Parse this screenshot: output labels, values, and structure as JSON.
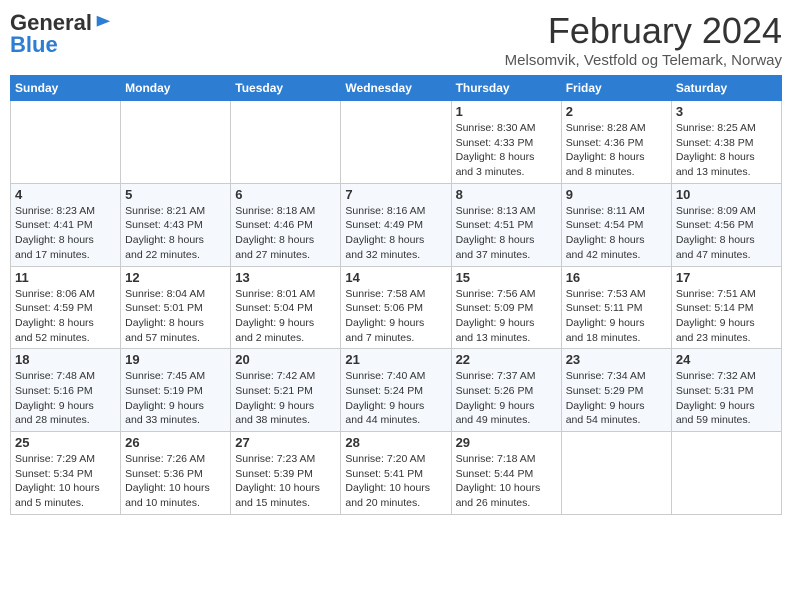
{
  "header": {
    "logo_line1": "General",
    "logo_line2": "Blue",
    "month_title": "February 2024",
    "location": "Melsomvik, Vestfold og Telemark, Norway"
  },
  "days_of_week": [
    "Sunday",
    "Monday",
    "Tuesday",
    "Wednesday",
    "Thursday",
    "Friday",
    "Saturday"
  ],
  "weeks": [
    [
      {
        "num": "",
        "info": ""
      },
      {
        "num": "",
        "info": ""
      },
      {
        "num": "",
        "info": ""
      },
      {
        "num": "",
        "info": ""
      },
      {
        "num": "1",
        "info": "Sunrise: 8:30 AM\nSunset: 4:33 PM\nDaylight: 8 hours\nand 3 minutes."
      },
      {
        "num": "2",
        "info": "Sunrise: 8:28 AM\nSunset: 4:36 PM\nDaylight: 8 hours\nand 8 minutes."
      },
      {
        "num": "3",
        "info": "Sunrise: 8:25 AM\nSunset: 4:38 PM\nDaylight: 8 hours\nand 13 minutes."
      }
    ],
    [
      {
        "num": "4",
        "info": "Sunrise: 8:23 AM\nSunset: 4:41 PM\nDaylight: 8 hours\nand 17 minutes."
      },
      {
        "num": "5",
        "info": "Sunrise: 8:21 AM\nSunset: 4:43 PM\nDaylight: 8 hours\nand 22 minutes."
      },
      {
        "num": "6",
        "info": "Sunrise: 8:18 AM\nSunset: 4:46 PM\nDaylight: 8 hours\nand 27 minutes."
      },
      {
        "num": "7",
        "info": "Sunrise: 8:16 AM\nSunset: 4:49 PM\nDaylight: 8 hours\nand 32 minutes."
      },
      {
        "num": "8",
        "info": "Sunrise: 8:13 AM\nSunset: 4:51 PM\nDaylight: 8 hours\nand 37 minutes."
      },
      {
        "num": "9",
        "info": "Sunrise: 8:11 AM\nSunset: 4:54 PM\nDaylight: 8 hours\nand 42 minutes."
      },
      {
        "num": "10",
        "info": "Sunrise: 8:09 AM\nSunset: 4:56 PM\nDaylight: 8 hours\nand 47 minutes."
      }
    ],
    [
      {
        "num": "11",
        "info": "Sunrise: 8:06 AM\nSunset: 4:59 PM\nDaylight: 8 hours\nand 52 minutes."
      },
      {
        "num": "12",
        "info": "Sunrise: 8:04 AM\nSunset: 5:01 PM\nDaylight: 8 hours\nand 57 minutes."
      },
      {
        "num": "13",
        "info": "Sunrise: 8:01 AM\nSunset: 5:04 PM\nDaylight: 9 hours\nand 2 minutes."
      },
      {
        "num": "14",
        "info": "Sunrise: 7:58 AM\nSunset: 5:06 PM\nDaylight: 9 hours\nand 7 minutes."
      },
      {
        "num": "15",
        "info": "Sunrise: 7:56 AM\nSunset: 5:09 PM\nDaylight: 9 hours\nand 13 minutes."
      },
      {
        "num": "16",
        "info": "Sunrise: 7:53 AM\nSunset: 5:11 PM\nDaylight: 9 hours\nand 18 minutes."
      },
      {
        "num": "17",
        "info": "Sunrise: 7:51 AM\nSunset: 5:14 PM\nDaylight: 9 hours\nand 23 minutes."
      }
    ],
    [
      {
        "num": "18",
        "info": "Sunrise: 7:48 AM\nSunset: 5:16 PM\nDaylight: 9 hours\nand 28 minutes."
      },
      {
        "num": "19",
        "info": "Sunrise: 7:45 AM\nSunset: 5:19 PM\nDaylight: 9 hours\nand 33 minutes."
      },
      {
        "num": "20",
        "info": "Sunrise: 7:42 AM\nSunset: 5:21 PM\nDaylight: 9 hours\nand 38 minutes."
      },
      {
        "num": "21",
        "info": "Sunrise: 7:40 AM\nSunset: 5:24 PM\nDaylight: 9 hours\nand 44 minutes."
      },
      {
        "num": "22",
        "info": "Sunrise: 7:37 AM\nSunset: 5:26 PM\nDaylight: 9 hours\nand 49 minutes."
      },
      {
        "num": "23",
        "info": "Sunrise: 7:34 AM\nSunset: 5:29 PM\nDaylight: 9 hours\nand 54 minutes."
      },
      {
        "num": "24",
        "info": "Sunrise: 7:32 AM\nSunset: 5:31 PM\nDaylight: 9 hours\nand 59 minutes."
      }
    ],
    [
      {
        "num": "25",
        "info": "Sunrise: 7:29 AM\nSunset: 5:34 PM\nDaylight: 10 hours\nand 5 minutes."
      },
      {
        "num": "26",
        "info": "Sunrise: 7:26 AM\nSunset: 5:36 PM\nDaylight: 10 hours\nand 10 minutes."
      },
      {
        "num": "27",
        "info": "Sunrise: 7:23 AM\nSunset: 5:39 PM\nDaylight: 10 hours\nand 15 minutes."
      },
      {
        "num": "28",
        "info": "Sunrise: 7:20 AM\nSunset: 5:41 PM\nDaylight: 10 hours\nand 20 minutes."
      },
      {
        "num": "29",
        "info": "Sunrise: 7:18 AM\nSunset: 5:44 PM\nDaylight: 10 hours\nand 26 minutes."
      },
      {
        "num": "",
        "info": ""
      },
      {
        "num": "",
        "info": ""
      }
    ]
  ]
}
